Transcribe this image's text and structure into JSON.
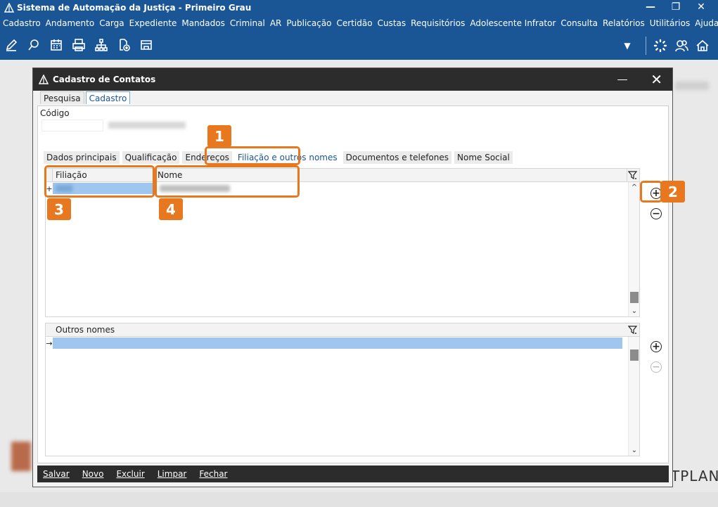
{
  "app": {
    "title": "Sistema de Automação da Justiça - Primeiro Grau",
    "menu": [
      "Cadastro",
      "Andamento",
      "Carga",
      "Expediente",
      "Mandados",
      "Criminal",
      "AR",
      "Publicação",
      "Certidão",
      "Custas",
      "Requisitórios",
      "Adolescente Infrator",
      "Consulta",
      "Relatórios",
      "Utilitários",
      "Ajuda"
    ],
    "toolbar_icons": [
      "edit-icon",
      "search-icon",
      "calendar-icon",
      "print-icon",
      "hierarchy-icon",
      "add-document-icon",
      "folder-icon"
    ],
    "brand_text": "TPLAN"
  },
  "dialog": {
    "title": "Cadastro de Contatos",
    "top_tabs": [
      "Pesquisa",
      "Cadastro"
    ],
    "codigo_label": "Código",
    "inner_tabs": [
      "Dados principais",
      "Qualificação",
      "Endereços",
      "Filiação e outros nomes",
      "Documentos e telefones",
      "Nome Social"
    ],
    "grid1": {
      "col_filiacao": "Filiação",
      "col_nome": "Nome",
      "row_marker": "+"
    },
    "grid2": {
      "col_outros": "Outros nomes",
      "row_marker": "→"
    },
    "bottom_buttons": [
      "Salvar",
      "Novo",
      "Excluir",
      "Limpar",
      "Fechar"
    ]
  },
  "callouts": [
    "1",
    "2",
    "3",
    "4"
  ],
  "colors": {
    "app_blue": "#1a5596",
    "callout_orange": "#e8781f",
    "selection_blue": "#9ec6ee"
  }
}
